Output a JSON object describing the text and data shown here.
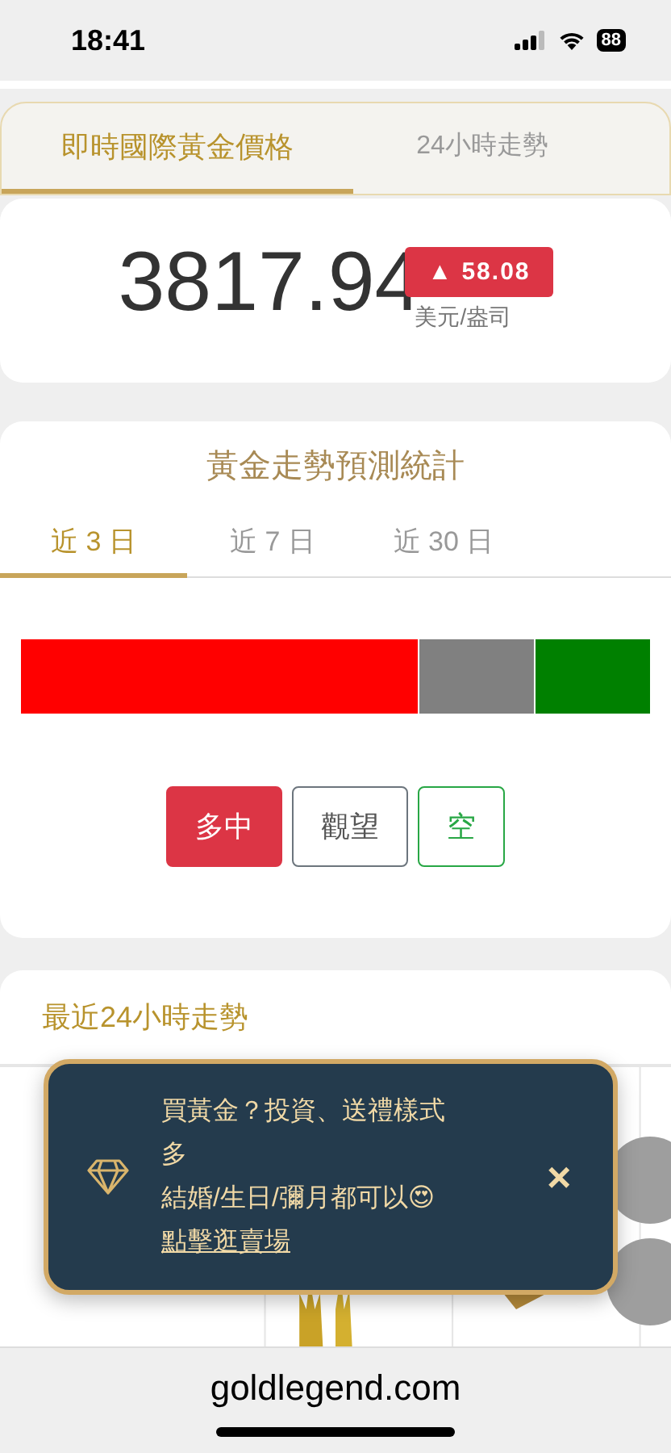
{
  "status_bar": {
    "time": "18:41",
    "battery": "88"
  },
  "tabs": [
    {
      "label": "即時國際黃金價格",
      "selected": true
    },
    {
      "label": "24小時走勢",
      "selected": false
    }
  ],
  "price": {
    "value": "3817.94",
    "change": "▲ 58.08",
    "unit": "美元/盎司"
  },
  "forecast": {
    "title": "黃金走勢預測統計",
    "periods": [
      {
        "label": "近 3 日",
        "selected": true
      },
      {
        "label": "近 7 日",
        "selected": false
      },
      {
        "label": "近 30 日",
        "selected": false
      }
    ],
    "segments": [
      {
        "color": "#ff0000"
      },
      {
        "color": "#808080"
      },
      {
        "color": "#008000"
      }
    ],
    "options": [
      {
        "label": "多中",
        "kind": "bull",
        "selected": true
      },
      {
        "label": "觀望",
        "kind": "neutral",
        "selected": false
      },
      {
        "label": "空",
        "kind": "bear",
        "selected": false
      }
    ]
  },
  "trend": {
    "title": "最近24小時走勢"
  },
  "toast": {
    "lines": [
      "買黃金？投資、送禮樣式多",
      "結婚/生日/彌月都可以😍"
    ],
    "link": "點擊逛賣場",
    "close": "×"
  },
  "browser": {
    "url": "goldlegend.com"
  }
}
